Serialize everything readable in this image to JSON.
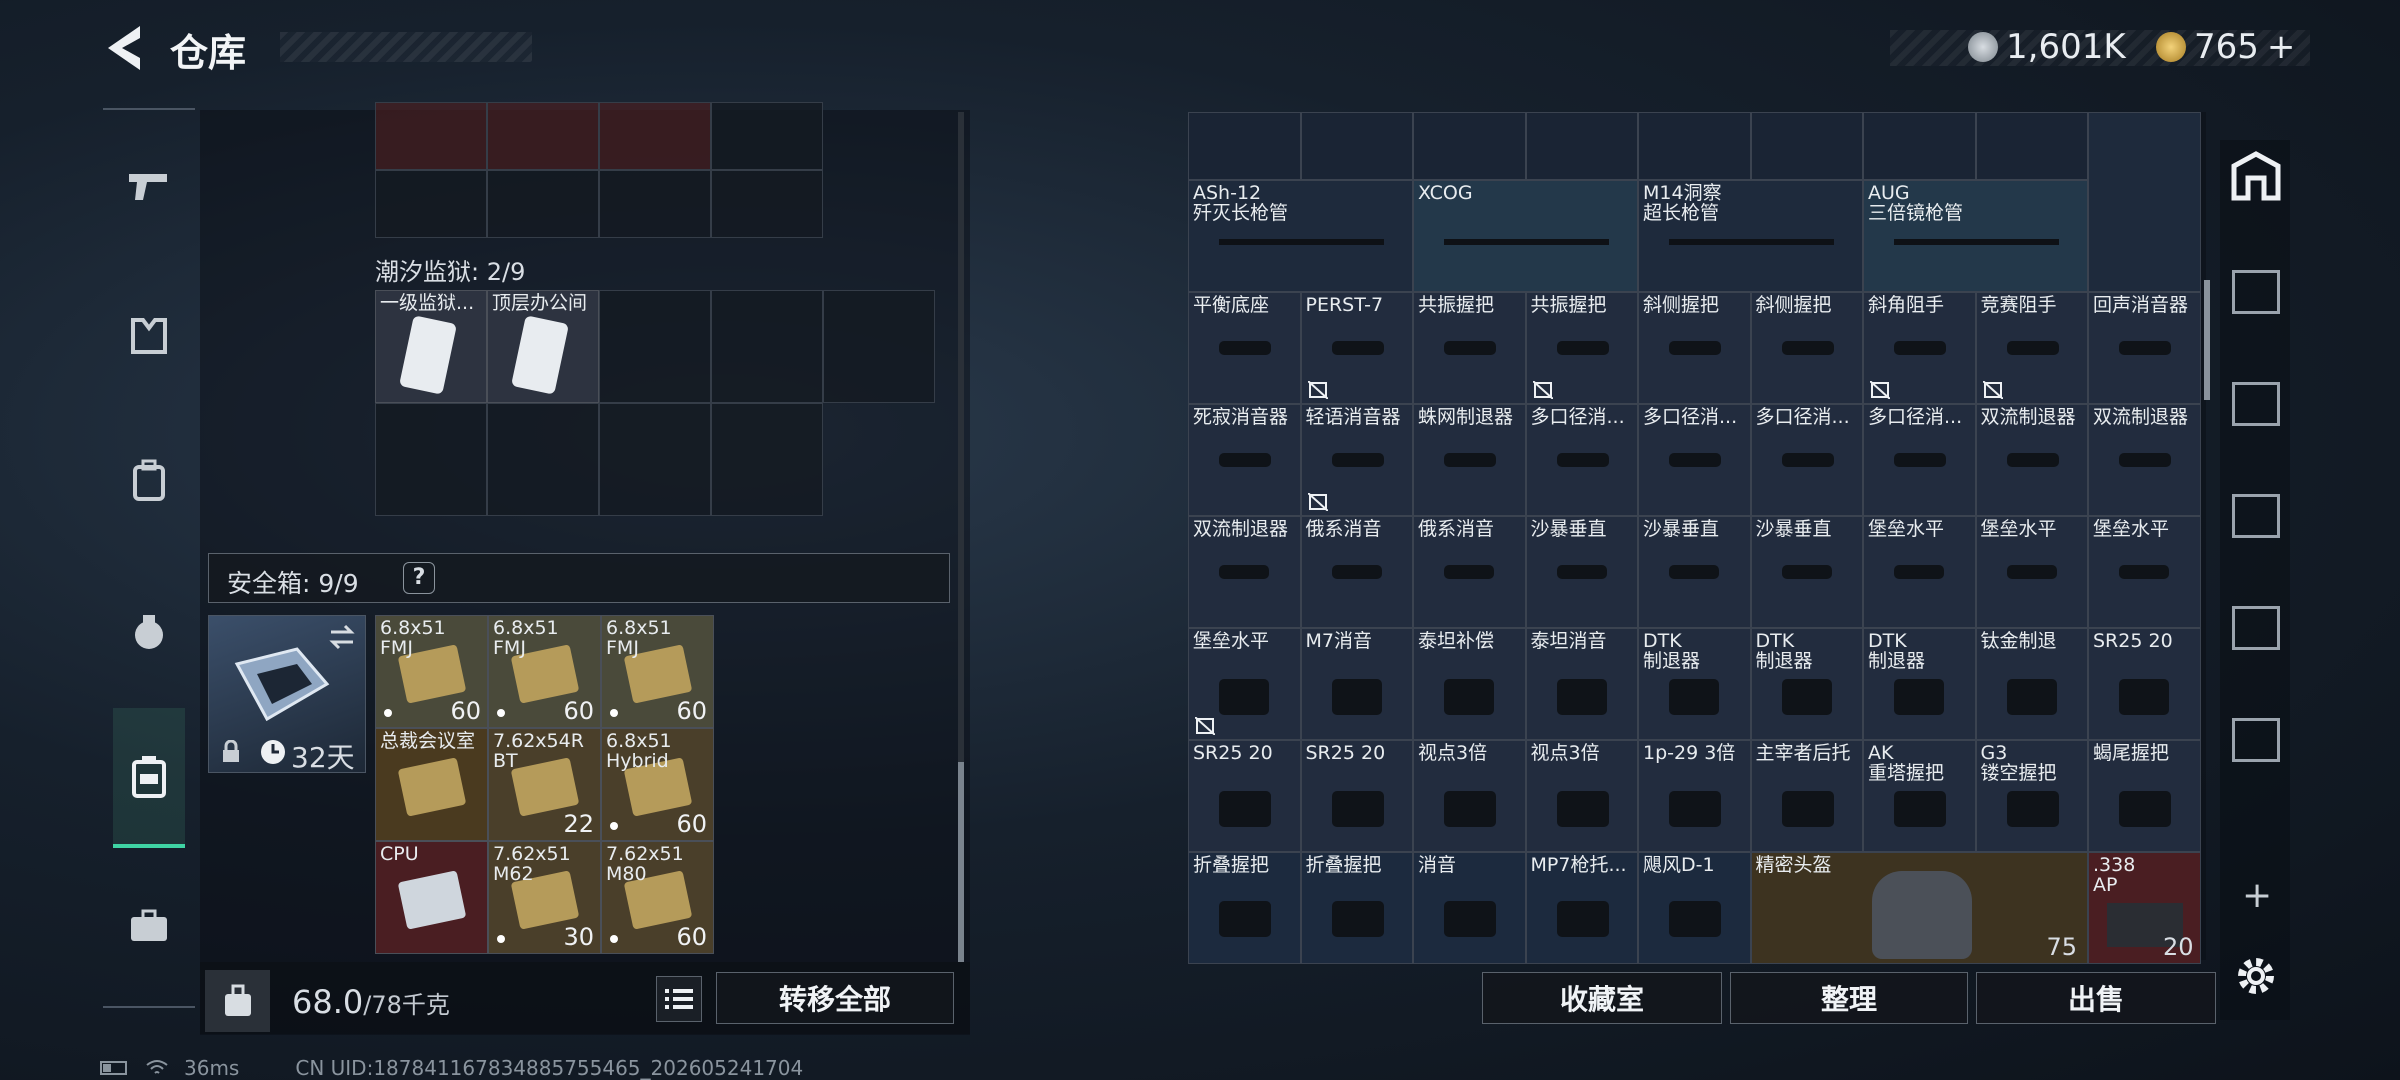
{
  "header": {
    "title": "仓库"
  },
  "currency": {
    "silver": "1,601K",
    "gold": "765",
    "gold_add": "+"
  },
  "left_panel": {
    "prison_label": "潮汐监狱: 2/9",
    "prison_items": [
      {
        "label": "一级监狱...",
        "icon": "keycard-icon"
      },
      {
        "label": "顶层办公间",
        "icon": "keycard-icon"
      }
    ],
    "safe_box": {
      "label": "安全箱: 9/9",
      "help": "?",
      "days": "32天"
    },
    "safe_items": [
      {
        "label": "6.8x51\nFMJ",
        "count": "60"
      },
      {
        "label": "6.8x51\nFMJ",
        "count": "60"
      },
      {
        "label": "6.8x51\nFMJ",
        "count": "60"
      },
      {
        "label": "总裁会议室",
        "count": ""
      },
      {
        "label": "7.62x54R\nBT",
        "count": "22"
      },
      {
        "label": "6.8x51\nHybrid",
        "count": "60"
      },
      {
        "label": "CPU",
        "count": ""
      },
      {
        "label": "7.62x51\nM62",
        "count": "30"
      },
      {
        "label": "7.62x51\nM80",
        "count": "60"
      }
    ],
    "weight": {
      "current": "68.0",
      "max": "/78千克"
    },
    "transfer_all": "转移全部"
  },
  "right_panel": {
    "top_items": [
      {
        "label": "ASh-12\n歼灭长枪管"
      },
      {
        "label": "XCOG"
      },
      {
        "label": "M14洞察\n超长枪管"
      },
      {
        "label": "AUG\n三倍镜枪管"
      }
    ],
    "grid": [
      [
        "平衡底座",
        "PERST-7",
        "共振握把",
        "共振握把",
        "斜侧握把",
        "斜侧握把",
        "斜角阻手",
        "竞赛阻手",
        "回声消音器"
      ],
      [
        "死寂消音器",
        "轻语消音器",
        "蛛网制退器",
        "多口径消...",
        "多口径消...",
        "多口径消...",
        "多口径消...",
        "双流制退器",
        "双流制退器"
      ],
      [
        "双流制退器",
        "俄系消音",
        "俄系消音",
        "沙暴垂直",
        "沙暴垂直",
        "沙暴垂直",
        "堡垒水平",
        "堡垒水平",
        "堡垒水平"
      ],
      [
        "堡垒水平",
        "M7消音",
        "泰坦补偿",
        "泰坦消音",
        "DTK\n制退器",
        "DTK\n制退器",
        "DTK\n制退器",
        "钛金制退",
        "SR25 20"
      ],
      [
        "SR25 20",
        "SR25 20",
        "视点3倍",
        "视点3倍",
        "1p-29 3倍",
        "主宰者后托",
        "AK\n重塔握把",
        "G3\n镂空握把",
        "蝎尾握把"
      ],
      [
        "折叠握把",
        "折叠握把",
        "消音",
        "MP7枪托...",
        "飓风D-1",
        "精密头盔",
        "",
        "",
        ".338\nAP"
      ]
    ],
    "helmet_durability": "75",
    "ammo_count": "20",
    "buttons": {
      "collection": "收藏室",
      "sort": "整理",
      "sell": "出售"
    }
  },
  "status": {
    "ping": "36ms",
    "uid": "CN UID:187841167834885755465_202605241704"
  },
  "colors": {
    "accent_green": "#3fd4a4",
    "cell_blue": "#1c2a3e",
    "cell_red": "#4a1e22",
    "cell_gold": "#3d3320"
  }
}
